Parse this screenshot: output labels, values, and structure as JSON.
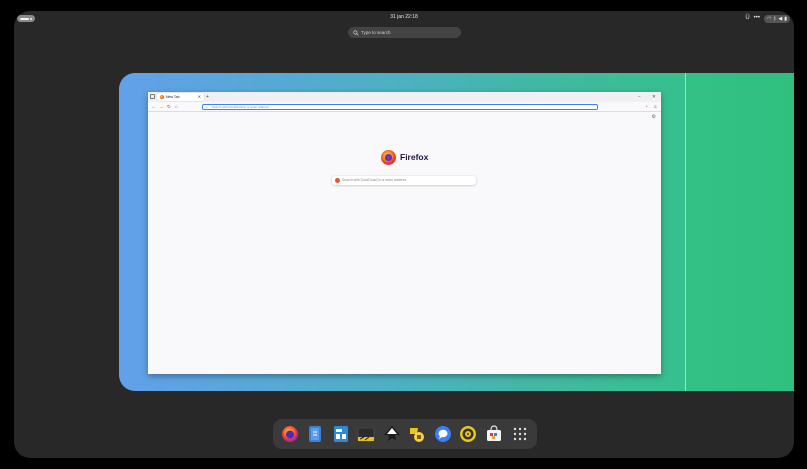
{
  "topbar": {
    "clock": "31 jan  22:18",
    "tray_indicator": "Ü",
    "tray_more": "•••"
  },
  "overview": {
    "search_placeholder": "Type to search"
  },
  "firefox": {
    "tab_title": "New Tab",
    "url_placeholder": "Search with DuckDuckGo or enter address",
    "brand": "Firefox",
    "ntp_search_placeholder": "Search with DuckDuckGo or enter address"
  },
  "dock": {
    "items": [
      "firefox-icon",
      "text-editor-icon",
      "office-writer-icon",
      "terminal-icon",
      "inkscape-icon",
      "files-icon",
      "chat-icon",
      "music-player-icon",
      "software-store-icon",
      "app-grid-icon"
    ]
  },
  "colors": {
    "workspace_gradient_start": "#62a0ea",
    "workspace_gradient_end": "#33c28a",
    "desktop_background": "#282828"
  }
}
